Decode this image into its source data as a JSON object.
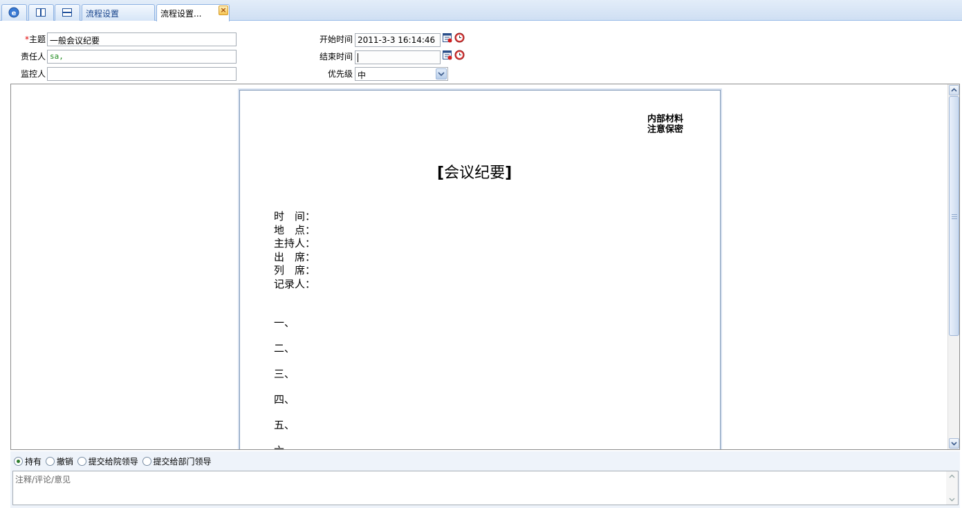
{
  "tabs": {
    "home_icon": "home-icon",
    "layout_icon_1": "split-vertical-icon",
    "layout_icon_2": "split-horizontal-icon",
    "tab1": "流程设置",
    "tab2": "流程设置...",
    "close": "×"
  },
  "form": {
    "required_mark": "*",
    "subject_label": "主题",
    "subject_value": "一般会议纪要",
    "owner_label": "责任人",
    "owner_value": "sa,",
    "monitor_label": "监控人",
    "monitor_value": "",
    "start_label": "开始时间",
    "start_value": "2011-3-3 16:14:46",
    "end_label": "结束时间",
    "end_value": "",
    "priority_label": "优先级",
    "priority_value": "中"
  },
  "document": {
    "mark_line1": "内部材料",
    "mark_line2": "注意保密",
    "title_open": "[",
    "title": "会议纪要",
    "title_close": "]",
    "fields": [
      "时　间：",
      "地　点：",
      "主持人：",
      "出　席：",
      "列　席：",
      "记录人："
    ],
    "items": [
      "一、",
      "二、",
      "三、",
      "四、",
      "五、",
      "六、"
    ]
  },
  "actions": {
    "options": [
      "持有",
      "撤销",
      "提交给院领导",
      "提交给部门领导"
    ],
    "selected": "持有",
    "comment_placeholder": "注释/评论/意见"
  },
  "colors": {
    "tab_text": "#15428b",
    "required": "#e00000",
    "owner_text": "#1d8a1d"
  }
}
